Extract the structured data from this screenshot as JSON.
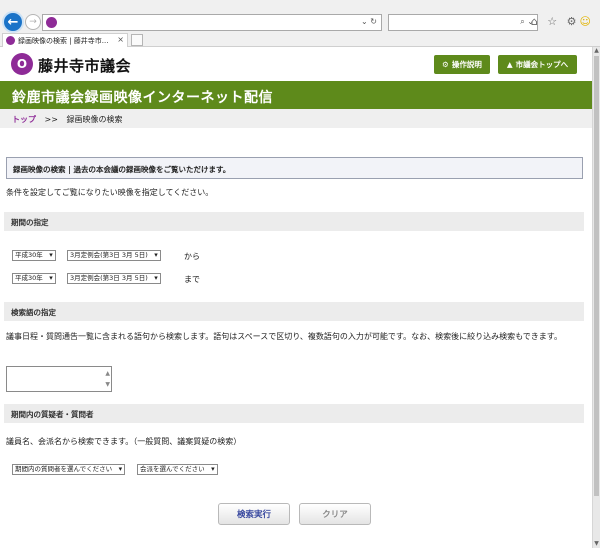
{
  "browser": {
    "tab_title": "録画映像の検索 | 藤井寺市...",
    "tab_close": "×",
    "address_icons": "⌄ ↻",
    "search_icons": "⌕ ⌄",
    "toolbar_icons": "⌂ ☆ ⚙",
    "smiley": "☺",
    "back": "←",
    "forward": "→"
  },
  "header": {
    "logo_mark": "O",
    "logo_text": "藤井寺市議会",
    "manual_button": "操作説明",
    "manual_icon": "⚙",
    "top_button": "市議会トップへ",
    "top_icon": "▲"
  },
  "banner": {
    "title": "鈴鹿市議会録画映像インターネット配信"
  },
  "breadcrumb": {
    "home": "トップ",
    "separator": ">>",
    "current": "録画映像の検索"
  },
  "notice": {
    "text": "録画映像の検索 | 過去の本会議の録画映像をご覧いただけます。"
  },
  "intro": "条件を設定してご覧になりたい映像を指定してください。",
  "period": {
    "heading": "期間の指定",
    "from_era": "平成30年",
    "from_session": "3月定例会(第3日 3月 5日)",
    "from_label": "から",
    "to_era": "平成30年",
    "to_session": "3月定例会(第3日 3月 5日)",
    "to_label": "まで"
  },
  "keyword": {
    "heading": "検索語の指定",
    "description": "議事日程・質問通告一覧に含まれる語句から検索します。語句はスペースで区切り、複数語句の入力が可能です。なお、検索後に絞り込み検索もできます。",
    "value": ""
  },
  "speaker": {
    "heading": "期間内の質疑者・質問者",
    "description": "議員名、会派名から検索できます。（一般質問、議案質疑の検索）",
    "member_select": "期間内の質問者を選んでください",
    "party_select": "会派を選んでください"
  },
  "actions": {
    "search": "検索実行",
    "clear": "クリア"
  },
  "scrollbar": {
    "up": "▲",
    "down": "▼"
  },
  "colors": {
    "brand_green": "#5e8a1b",
    "brand_purple": "#8e2b97"
  }
}
